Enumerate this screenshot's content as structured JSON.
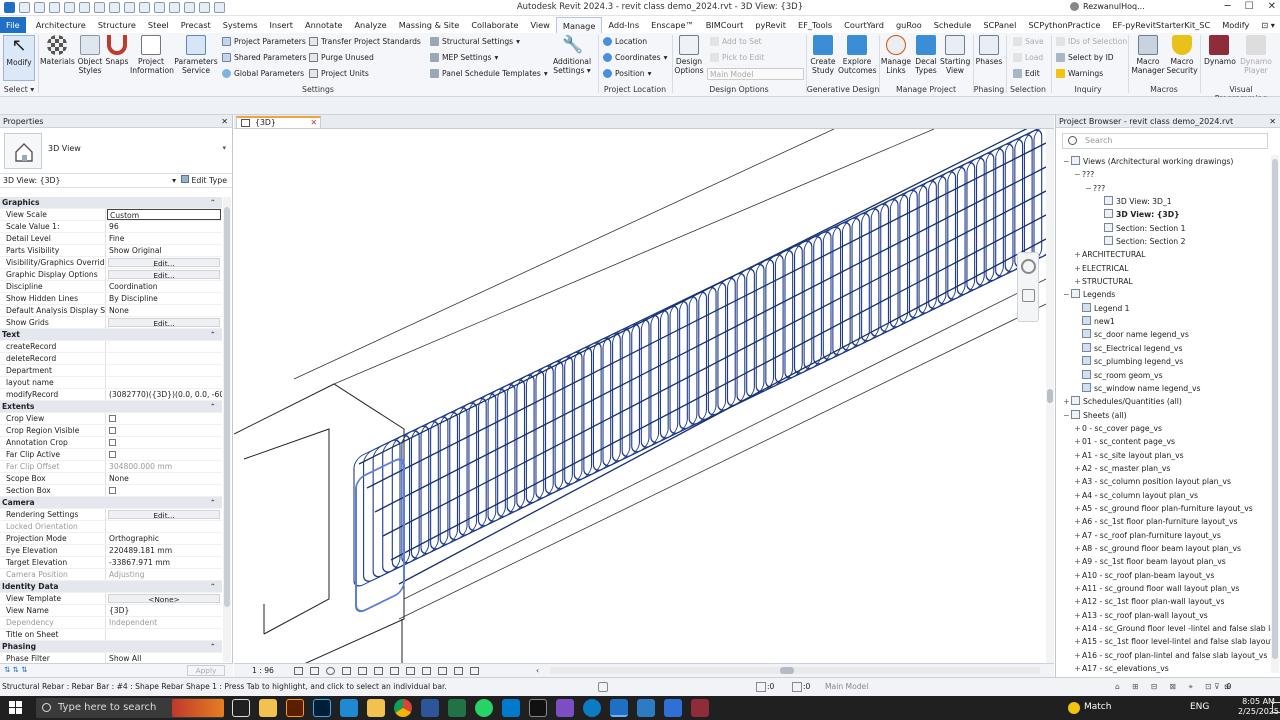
{
  "titlebar": {
    "app_title": "Autodesk Revit 2024.3 - revit class demo_2024.rvt - 3D View: {3D}",
    "user": "RezwanulHoq..."
  },
  "menu_tabs": [
    "File",
    "Architecture",
    "Structure",
    "Steel",
    "Precast",
    "Systems",
    "Insert",
    "Annotate",
    "Analyze",
    "Massing & Site",
    "Collaborate",
    "View",
    "Manage",
    "Add-Ins",
    "Enscape™",
    "BIMCourt",
    "pyRevit",
    "EF_Tools",
    "CourtYard",
    "guRoo",
    "Schedule",
    "SCPanel",
    "SCPythonPractice",
    "EF-pyRevitStarterKit_SC",
    "Modify"
  ],
  "active_tab": "Manage",
  "ribbon": {
    "modify": "Modify",
    "materials": "Materials",
    "object_styles": "Object Styles",
    "snaps": "Snaps",
    "project_information": "Project Information",
    "parameters_service": "Parameters Service",
    "project_parameters": "Project Parameters",
    "shared_parameters": "Shared Parameters",
    "global_parameters": "Global Parameters",
    "transfer_project_standards": "Transfer Project Standards",
    "purge_unused": "Purge Unused",
    "project_units": "Project Units",
    "structural_settings": "Structural Settings",
    "mep_settings": "MEP Settings",
    "panel_schedule_templates": "Panel Schedule Templates",
    "additional_settings": "Additional Settings",
    "location": "Location",
    "coordinates": "Coordinates",
    "position": "Position",
    "design_options": "Design Options",
    "add_to_set": "Add to Set",
    "pick_to_edit": "Pick to Edit",
    "main_model": "Main Model",
    "create_study": "Create Study",
    "explore_outcomes": "Explore Outcomes",
    "manage_links": "Manage Links",
    "decal_types": "Decal Types",
    "starting_view": "Starting View",
    "phases": "Phases",
    "save": "Save",
    "load": "Load",
    "edit": "Edit",
    "ids_of_selection": "IDs of Selection",
    "select_by_id": "Select by ID",
    "warnings": "Warnings",
    "macro_manager": "Macro Manager",
    "macro_security": "Macro Security",
    "dynamo": "Dynamo",
    "dynamo_player": "Dynamo Player",
    "panels": {
      "select": "Select",
      "settings": "Settings",
      "project_location": "Project Location",
      "design_options": "Design Options",
      "generative_design": "Generative Design",
      "manage_project": "Manage Project",
      "phasing": "Phasing",
      "selection": "Selection",
      "inquiry": "Inquiry",
      "macros": "Macros",
      "visual_programming": "Visual Programming"
    }
  },
  "properties": {
    "header": "Properties",
    "type_label": "3D View",
    "selector": "3D View: {3D}",
    "edit_type": "Edit Type",
    "rows": [
      {
        "kind": "cat",
        "k": "Graphics"
      },
      {
        "k": "View Scale",
        "v": "Custom",
        "style": "boxed"
      },
      {
        "k": "Scale Value    1:",
        "v": "96"
      },
      {
        "k": "Detail Level",
        "v": "Fine"
      },
      {
        "k": "Parts Visibility",
        "v": "Show Original"
      },
      {
        "k": "Visibility/Graphics Overrides",
        "v": "Edit...",
        "style": "btn"
      },
      {
        "k": "Graphic Display Options",
        "v": "Edit...",
        "style": "btn"
      },
      {
        "k": "Discipline",
        "v": "Coordination"
      },
      {
        "k": "Show Hidden Lines",
        "v": "By Discipline"
      },
      {
        "k": "Default Analysis Display St...",
        "v": "None"
      },
      {
        "k": "Show Grids",
        "v": "Edit...",
        "style": "btn"
      },
      {
        "kind": "cat",
        "k": "Text"
      },
      {
        "k": "createRecord",
        "v": ""
      },
      {
        "k": "deleteRecord",
        "v": ""
      },
      {
        "k": "Department",
        "v": ""
      },
      {
        "k": "layout name",
        "v": ""
      },
      {
        "k": "modifyRecord",
        "v": "(3082770)({3D})(0.0, 0.0, -60..."
      },
      {
        "kind": "cat",
        "k": "Extents"
      },
      {
        "k": "Crop View",
        "v": "",
        "style": "cb"
      },
      {
        "k": "Crop Region Visible",
        "v": "",
        "style": "cb"
      },
      {
        "k": "Annotation Crop",
        "v": "",
        "style": "cb"
      },
      {
        "k": "Far Clip Active",
        "v": "",
        "style": "cb"
      },
      {
        "k": "Far Clip Offset",
        "v": "304800.000 mm",
        "style": "grey"
      },
      {
        "k": "Scope Box",
        "v": "None"
      },
      {
        "k": "Section Box",
        "v": "",
        "style": "cb"
      },
      {
        "kind": "cat",
        "k": "Camera"
      },
      {
        "k": "Rendering Settings",
        "v": "Edit...",
        "style": "btn"
      },
      {
        "k": "Locked Orientation",
        "v": "",
        "style": "grey"
      },
      {
        "k": "Projection Mode",
        "v": "Orthographic"
      },
      {
        "k": "Eye Elevation",
        "v": "220489.181 mm"
      },
      {
        "k": "Target Elevation",
        "v": "-33867.971 mm"
      },
      {
        "k": "Camera Position",
        "v": "Adjusting",
        "style": "grey"
      },
      {
        "kind": "cat",
        "k": "Identity Data"
      },
      {
        "k": "View Template",
        "v": "<None>",
        "style": "btn"
      },
      {
        "k": "View Name",
        "v": "{3D}"
      },
      {
        "k": "Dependency",
        "v": "Independent",
        "style": "grey"
      },
      {
        "k": "Title on Sheet",
        "v": ""
      },
      {
        "kind": "cat",
        "k": "Phasing"
      },
      {
        "k": "Phase Filter",
        "v": "Show All"
      }
    ],
    "apply": "Apply"
  },
  "view": {
    "tab": "{3D}",
    "scale": "1 : 96"
  },
  "browser": {
    "header": "Project Browser - revit class demo_2024.rvt",
    "search_placeholder": "Search",
    "nodes": [
      {
        "t": "Views (Architectural working drawings)",
        "d": 0,
        "tg": "−",
        "ic": true
      },
      {
        "t": "???",
        "d": 1,
        "tg": "−"
      },
      {
        "t": "???",
        "d": 2,
        "tg": "−"
      },
      {
        "t": "3D View: 3D_1",
        "d": 3,
        "ic": true
      },
      {
        "t": "3D View: {3D}",
        "d": 3,
        "ic": true,
        "bold": true
      },
      {
        "t": "Section: Section 1",
        "d": 3,
        "ic": true
      },
      {
        "t": "Section: Section 2",
        "d": 3,
        "ic": true
      },
      {
        "t": "ARCHITECTURAL",
        "d": 1,
        "tg": "+"
      },
      {
        "t": "ELECTRICAL",
        "d": 1,
        "tg": "+"
      },
      {
        "t": "STRUCTURAL",
        "d": 1,
        "tg": "+"
      },
      {
        "t": "Legends",
        "d": 0,
        "tg": "−",
        "ic": true
      },
      {
        "t": "Legend 1",
        "d": 1,
        "ic": true,
        "leg": true
      },
      {
        "t": "new1",
        "d": 1,
        "ic": true,
        "leg": true
      },
      {
        "t": "sc_door name legend_vs",
        "d": 1,
        "ic": true,
        "leg": true
      },
      {
        "t": "sc_Electrical legend_vs",
        "d": 1,
        "ic": true,
        "leg": true
      },
      {
        "t": "sc_plumbing legend_vs",
        "d": 1,
        "ic": true,
        "leg": true
      },
      {
        "t": "sc_room geom_vs",
        "d": 1,
        "ic": true,
        "leg": true
      },
      {
        "t": "sc_window name legend_vs",
        "d": 1,
        "ic": true,
        "leg": true
      },
      {
        "t": "Schedules/Quantities (all)",
        "d": 0,
        "tg": "+",
        "ic": true
      },
      {
        "t": "Sheets (all)",
        "d": 0,
        "tg": "−",
        "ic": true
      },
      {
        "t": "0 - sc_cover page_vs",
        "d": 1,
        "tg": "+"
      },
      {
        "t": "01 - sc_content page_vs",
        "d": 1,
        "tg": "+"
      },
      {
        "t": "A1 - sc_site layout plan_vs",
        "d": 1,
        "tg": "+"
      },
      {
        "t": "A2 - sc_master plan_vs",
        "d": 1,
        "tg": "+"
      },
      {
        "t": "A3 - sc_column position layout plan_vs",
        "d": 1,
        "tg": "+"
      },
      {
        "t": "A4 - sc_column layout plan_vs",
        "d": 1,
        "tg": "+"
      },
      {
        "t": "A5 - sc_ground floor plan-furniture layout_vs",
        "d": 1,
        "tg": "+"
      },
      {
        "t": "A6 - sc_1st floor plan-furniture layout_vs",
        "d": 1,
        "tg": "+"
      },
      {
        "t": "A7 - sc_roof plan-furniture layout_vs",
        "d": 1,
        "tg": "+"
      },
      {
        "t": "A8 - sc_ground floor beam layout plan_vs",
        "d": 1,
        "tg": "+"
      },
      {
        "t": "A9 - sc_1st floor beam layout plan_vs",
        "d": 1,
        "tg": "+"
      },
      {
        "t": "A10 - sc_roof plan-beam layout_vs",
        "d": 1,
        "tg": "+"
      },
      {
        "t": "A11 - sc_ground floor wall layout plan_vs",
        "d": 1,
        "tg": "+"
      },
      {
        "t": "A12 - sc_1st floor plan-wall layout_vs",
        "d": 1,
        "tg": "+"
      },
      {
        "t": "A13 - sc_roof plan-wall layout_vs",
        "d": 1,
        "tg": "+"
      },
      {
        "t": "A14 - sc_Ground floor level -lintel and false slab layout",
        "d": 1,
        "tg": "+"
      },
      {
        "t": "A15 - sc_1st floor level-lintel and false slab layout_vs",
        "d": 1,
        "tg": "+"
      },
      {
        "t": "A16 - sc_roof plan-lintel and false slab layout_vs",
        "d": 1,
        "tg": "+"
      },
      {
        "t": "A17 - sc_elevations_vs",
        "d": 1,
        "tg": "+"
      }
    ]
  },
  "status": {
    "message": "Structural Rebar : Rebar Bar : #4 : Shape Rebar Shape 1 : Press Tab to highlight, and click to select an individual bar.",
    "model": "Main Model",
    "zero1": ":0",
    "zero2": ":0"
  },
  "taskbar": {
    "search": "Type here to search",
    "lang": "ENG",
    "match": "Match",
    "time": "8:05 AM",
    "date": "2/25/2025"
  }
}
